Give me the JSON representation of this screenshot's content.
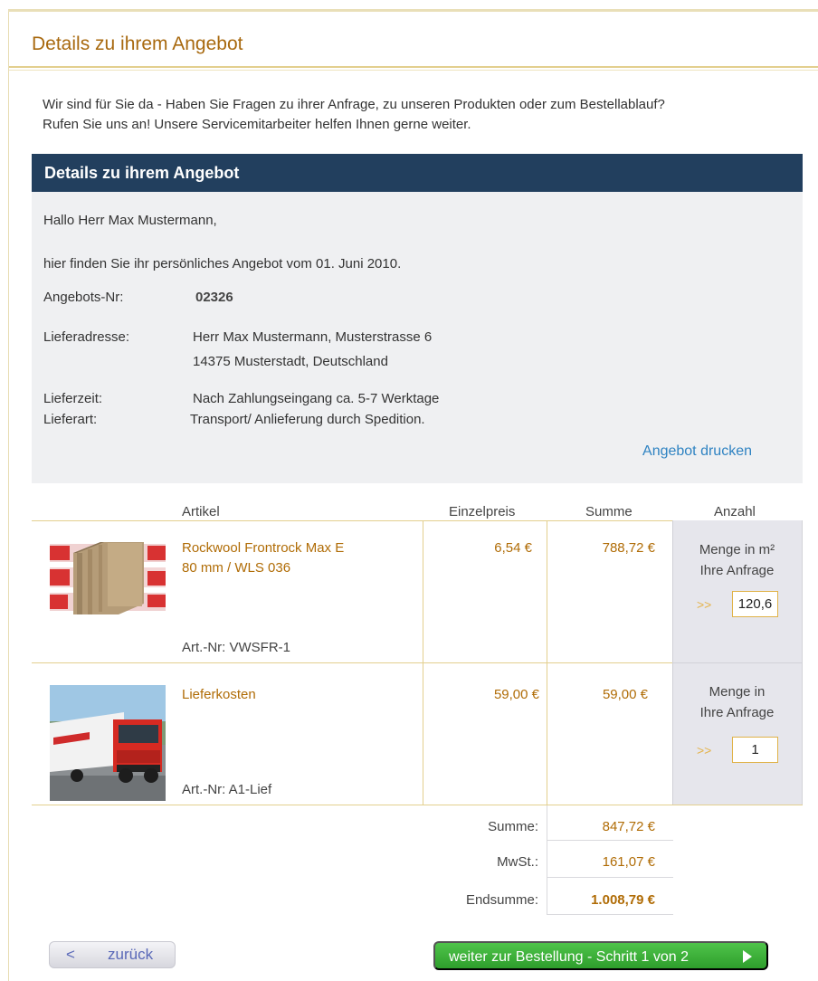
{
  "page": {
    "title": "Details zu ihrem Angebot",
    "intro_line1": "Wir sind für Sie da - Haben Sie Fragen zu ihrer Anfrage, zu unseren Produkten oder zum Bestellablauf?",
    "intro_line2": "Rufen Sie uns an! Unsere Servicemitarbeiter helfen Ihnen gerne weiter."
  },
  "offer": {
    "header": "Details zu ihrem Angebot",
    "greeting": "Hallo Herr Max Mustermann,",
    "intro": "hier finden Sie ihr persönliches Angebot vom 01. Juni 2010.",
    "number_label": "Angebots-Nr:",
    "number": "02326",
    "address_label": "Lieferadresse:",
    "address_line1": "Herr Max Mustermann, Musterstrasse 6",
    "address_line2": "14375 Musterstadt, Deutschland",
    "delivery_time_label": "Lieferzeit:",
    "delivery_time": "Nach Zahlungseingang ca. 5-7 Werktage",
    "delivery_type_label": "Lieferart:",
    "delivery_type": "Transport/ Anlieferung durch Spedition.",
    "print_link": "Angebot drucken"
  },
  "table": {
    "headers": {
      "article": "Artikel",
      "unit_price": "Einzelpreis",
      "sum": "Summe",
      "quantity": "Anzahl"
    },
    "rows": [
      {
        "name_line1": "Rockwool Frontrock Max E",
        "name_line2": "80 mm / WLS 036",
        "art_nr": "Art.-Nr: VWSFR-1",
        "unit_price": "6,54 €",
        "sum": "788,72 €",
        "qty_label_line1": "Menge in m²",
        "qty_label_line2": "Ihre Anfrage",
        "arrows": ">>",
        "qty": "120,6",
        "image_icon": "insulation-board-image"
      },
      {
        "name_line1": "Lieferkosten",
        "name_line2": "",
        "art_nr": "Art.-Nr: A1-Lief",
        "unit_price": "59,00 €",
        "sum": "59,00 €",
        "qty_label_line1": "Menge in",
        "qty_label_line2": "Ihre Anfrage",
        "arrows": ">>",
        "qty": "1",
        "image_icon": "delivery-truck-image"
      }
    ]
  },
  "totals": {
    "subtotal_label": "Summe:",
    "subtotal": "847,72 €",
    "vat_label": "MwSt.:",
    "vat": "161,07 €",
    "total_label": "Endsumme:",
    "total": "1.008,79 €"
  },
  "buttons": {
    "back_chevron": "<",
    "back_label": "zurück",
    "next_label": "weiter zur Bestellung - Schritt 1 von 2"
  },
  "colors": {
    "title": "#a8690f",
    "panel_header": "#223f5e",
    "accent": "#b06c06",
    "link": "#2f83c2",
    "next_button": "#3bb13a"
  }
}
